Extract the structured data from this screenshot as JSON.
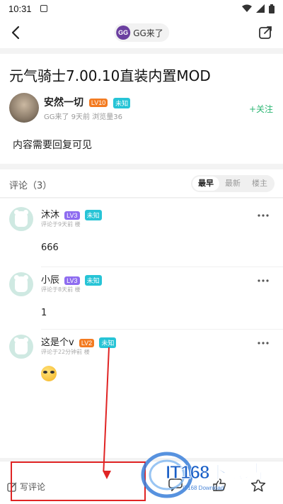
{
  "status_bar": {
    "time": "10:31"
  },
  "header": {
    "channel": "GG来了",
    "channel_logo": "GG"
  },
  "post": {
    "title": "元气骑士7.00.10直装内置MOD",
    "author": "安然一切",
    "author_level": "LV10",
    "author_tag": "未知",
    "meta": "GG来了  9天前  浏览量36",
    "follow_label": "+关注",
    "body": "内容需要回复可见"
  },
  "comments_header": {
    "title": "评论（3）",
    "sort": [
      "最早",
      "最新",
      "楼主"
    ],
    "active_sort": "最早"
  },
  "comments": [
    {
      "name": "沐沐",
      "level": "LV3",
      "tag": "未知",
      "meta": "评论于9天前  楼",
      "text": "666"
    },
    {
      "name": "小辰",
      "level": "LV3",
      "tag": "未知",
      "meta": "评论于8天前  楼",
      "text": "1"
    },
    {
      "name": "这是个v",
      "level": "LV2",
      "tag": "未知",
      "meta": "评论于22分钟前  楼",
      "text": "",
      "emoji": "face-emoji"
    }
  ],
  "bottom_bar": {
    "write_label": "写评论"
  },
  "watermark": {
    "title": "IT168下载站",
    "subtitle": "IT168 Download"
  },
  "colors": {
    "accent_green": "#2bb673",
    "level_orange": "#f37b21",
    "level_purple": "#8e6cf0",
    "tag_cyan": "#27c4d6",
    "annotation_red": "#e02424"
  }
}
